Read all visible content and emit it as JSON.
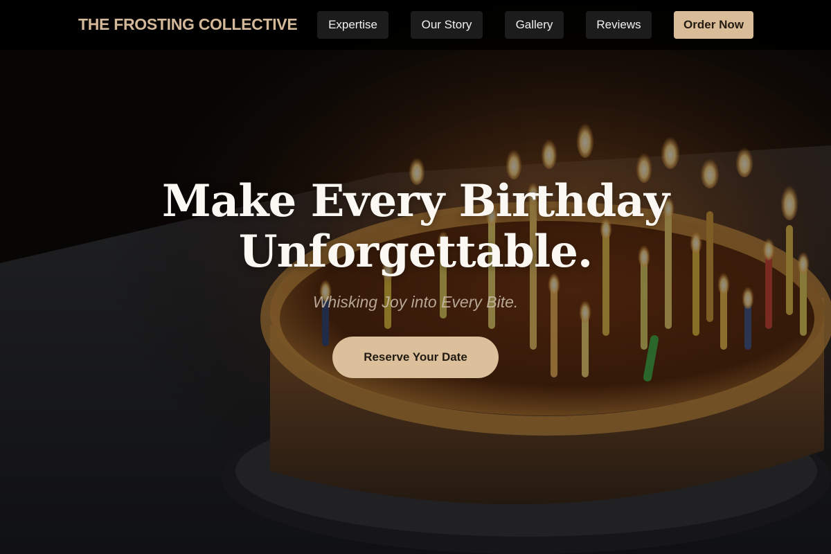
{
  "nav": {
    "brand": "THE FROSTING COLLECTIVE",
    "items": [
      {
        "label": "Expertise"
      },
      {
        "label": "Our Story"
      },
      {
        "label": "Gallery"
      },
      {
        "label": "Reviews"
      }
    ],
    "order_label": "Order Now"
  },
  "hero": {
    "headline_line1": "Make Every Birthday",
    "headline_line2": "Unforgettable.",
    "tagline": "Whisking Joy into Every Bite.",
    "cta_label": "Reserve Your Date",
    "background_image": "birthday-cake-with-lit-candles"
  },
  "colors": {
    "accent": "#d9bd98",
    "brand_text": "#d3b999",
    "nav_button_bg": "#1c1c1c",
    "nav_bar_bg": "#000000",
    "headline_text": "#fbf7f2"
  }
}
